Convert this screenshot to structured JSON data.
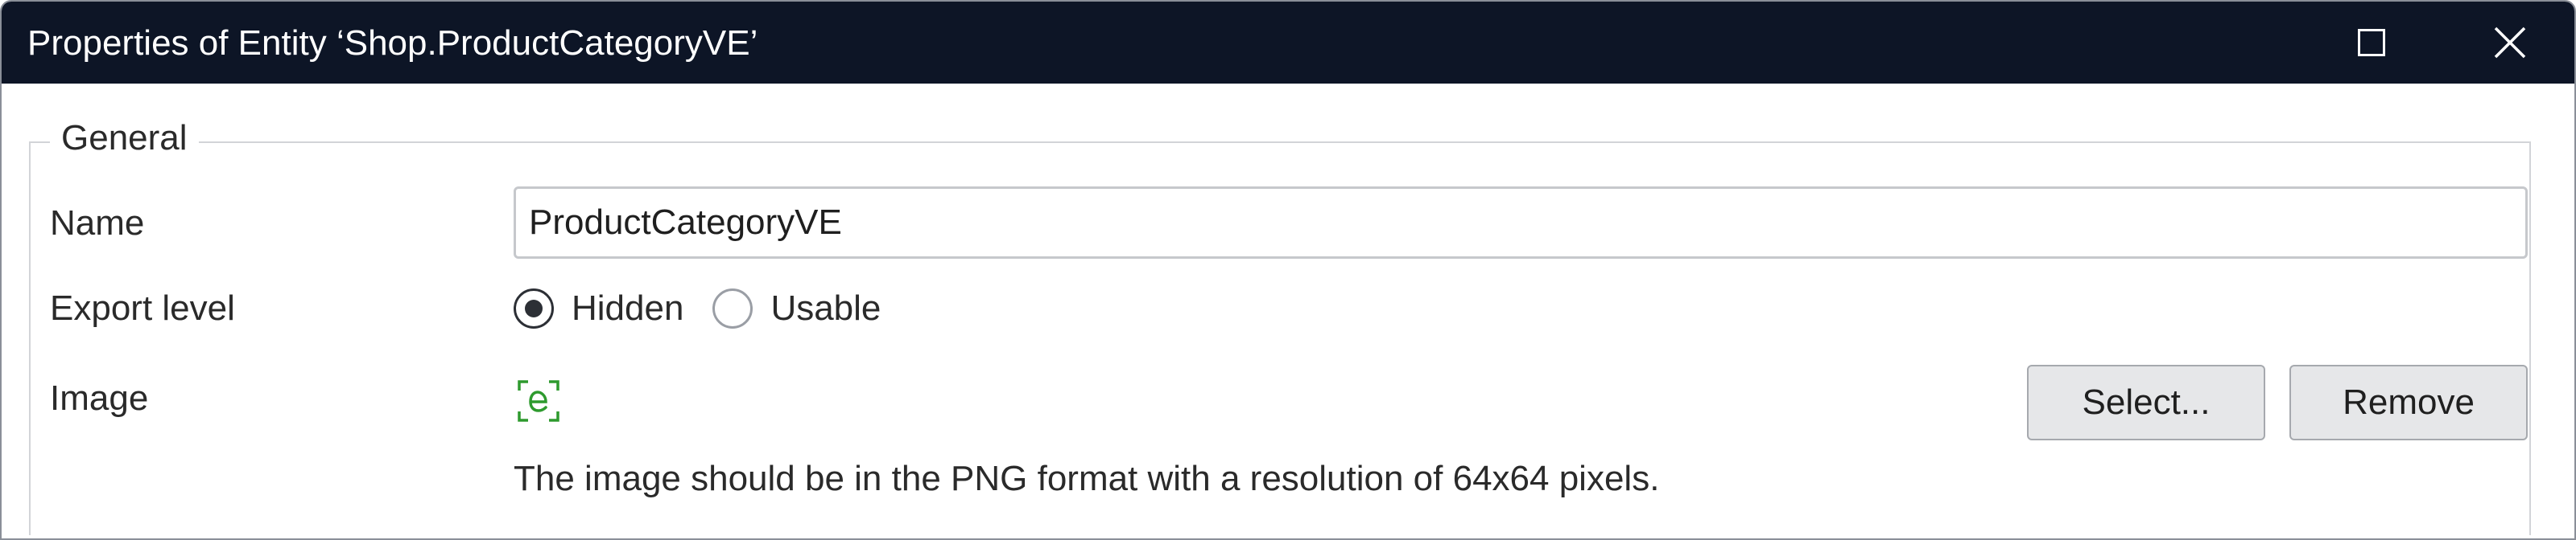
{
  "window": {
    "title": "Properties of Entity ‘Shop.ProductCategoryVE’"
  },
  "general": {
    "legend": "General",
    "name_label": "Name",
    "name_value": "ProductCategoryVE",
    "export_label": "Export level",
    "export_options": [
      {
        "label": "Hidden",
        "selected": true
      },
      {
        "label": "Usable",
        "selected": false
      }
    ],
    "image_label": "Image",
    "image_icon": "entity-icon",
    "select_button": "Select...",
    "remove_button": "Remove",
    "hint": "The image should be in the PNG format with a resolution of 64x64 pixels."
  },
  "colors": {
    "titlebar": "#0d1526",
    "icon_green": "#2e9a2e"
  }
}
